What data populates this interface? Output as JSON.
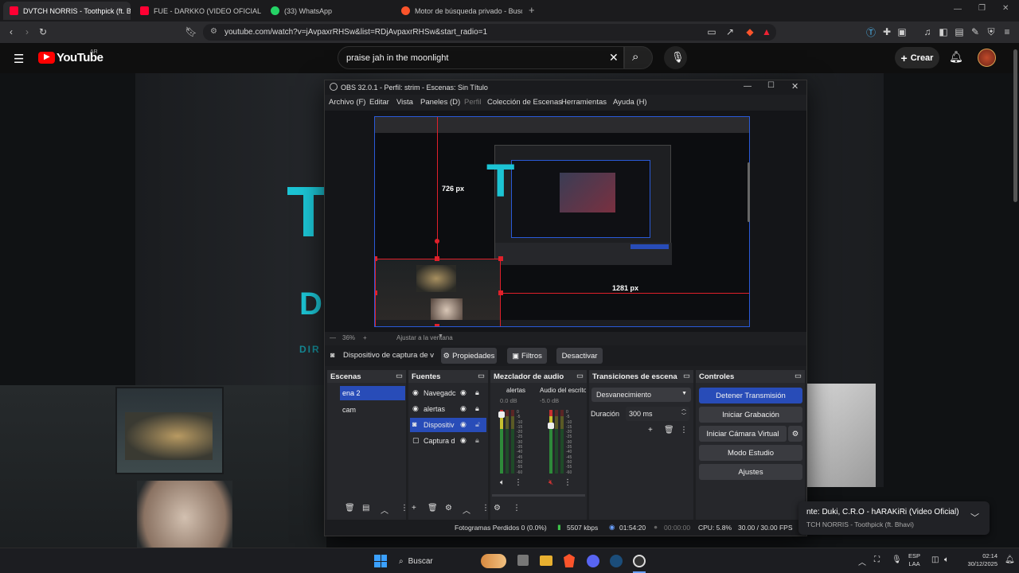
{
  "browser": {
    "tabs": [
      {
        "label": "DVTCH NORRIS - Toothpick (ft. B",
        "active": true
      },
      {
        "label": "FUE - DARKKO (VIDEO OFICIAL) - Yo",
        "active": false
      },
      {
        "label": "(33) WhatsApp",
        "active": false
      },
      {
        "label": "Motor de búsqueda privado - Busca",
        "active": false
      }
    ],
    "url": "youtube.com/watch?v=jAvpaxrRHSw&list=RDjAvpaxrRHSw&start_radio=1",
    "new_tab": "+"
  },
  "youtube": {
    "logo": "YouTube",
    "region": "AR",
    "search_query": "praise jah in the moonlight",
    "create_label": "Crear"
  },
  "video_text": {
    "big_letter": "T",
    "small_letters": "D",
    "small_dim": "DIR"
  },
  "obs": {
    "title": "OBS 32.0.1 - Perfil: strim - Escenas: Sin Título",
    "menu": [
      "Archivo (F)",
      "Editar",
      "Vista",
      "Paneles (D)",
      "Perfil",
      "Colección de Escenas",
      "Herramientas",
      "Ayuda (H)"
    ],
    "measure_726": "726 px",
    "measure_1281": "1281 px",
    "zoom": "36%",
    "fit": "Ajustar a la ventana",
    "source_bar": {
      "source": "Dispositivo de captura de v",
      "properties": "Propiedades",
      "filters": "Filtros",
      "deactivate": "Desactivar"
    },
    "scenes": {
      "header": "Escenas",
      "items": [
        "ena 2",
        "cam"
      ]
    },
    "sources": {
      "header": "Fuentes",
      "items": [
        "Navegadc",
        "alertas",
        "Dispositiv",
        "Captura d"
      ]
    },
    "mixer": {
      "header": "Mezclador de audio",
      "channels": [
        {
          "name": "alertas",
          "db": "0.0 dB"
        },
        {
          "name": "Audio del escritorio",
          "db": "-5.0 dB"
        }
      ],
      "scale": [
        "0",
        "-5",
        "-10",
        "-15",
        "-20",
        "-25",
        "-30",
        "-35",
        "-40",
        "-45",
        "-50",
        "-55",
        "-60"
      ]
    },
    "transitions": {
      "header": "Transiciones de escena",
      "selected": "Desvanecimiento",
      "duration_label": "Duración",
      "duration_value": "300 ms"
    },
    "controls": {
      "header": "Controles",
      "stop_stream": "Detener Transmisión",
      "start_record": "Iniciar Grabación",
      "virtual_cam": "Iniciar Cámara Virtual",
      "studio": "Modo Estudio",
      "settings": "Ajustes"
    },
    "status": {
      "dropped": "Fotogramas Perdidos 0 (0.0%)",
      "kbps": "5507 kbps",
      "stream_time": "01:54:20",
      "rec_time": "00:00:00",
      "cpu": "CPU: 5.8%",
      "fps": "30.00 / 30.00 FPS"
    }
  },
  "notification": {
    "line1": "nte: Duki, C.R.O - hARAKiRi (Video Oficial)",
    "line2": "TCH NORRIS - Toothpick (ft. Bhavi)"
  },
  "taskbar": {
    "search": "Buscar",
    "lang_top": "ESP",
    "lang_bottom": "LAA",
    "time": "02:14",
    "date": "30/12/2025"
  },
  "colors": {
    "accent": "#284cb8",
    "obs_bg": "#1e1f22",
    "yt_red": "#ff0000",
    "selection": "#e0202a"
  }
}
